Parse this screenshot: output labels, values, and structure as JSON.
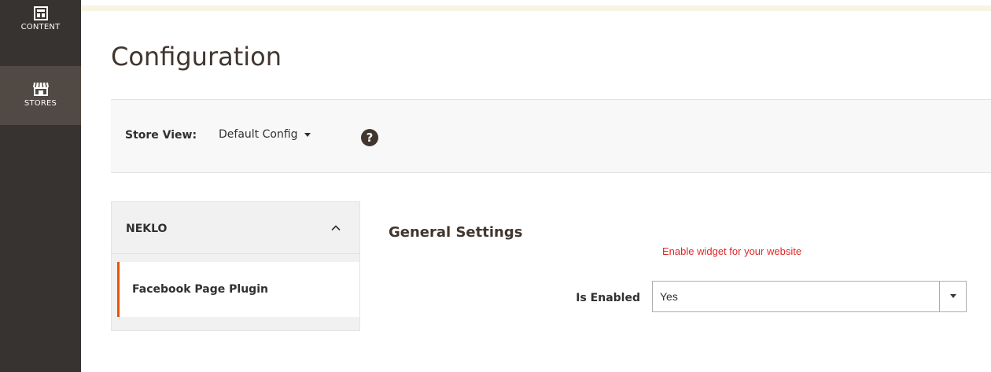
{
  "nav": {
    "items": [
      {
        "label": "CONTENT",
        "icon": "content-icon"
      },
      {
        "label": "STORES",
        "icon": "stores-icon"
      }
    ]
  },
  "page": {
    "title": "Configuration"
  },
  "store_view": {
    "label": "Store View:",
    "selected": "Default Config",
    "help_icon": "?"
  },
  "config_tabs": {
    "group_label": "NEKLO",
    "items": [
      {
        "label": "Facebook Page Plugin",
        "active": true
      }
    ]
  },
  "section": {
    "title": "General Settings",
    "fields": [
      {
        "label": "Is Enabled",
        "value": "Yes",
        "comment": "Enable widget for your website"
      }
    ]
  },
  "colors": {
    "nav_bg": "#373330",
    "nav_active_bg": "#514943",
    "accent": "#eb5202",
    "comment": "#e22626"
  }
}
